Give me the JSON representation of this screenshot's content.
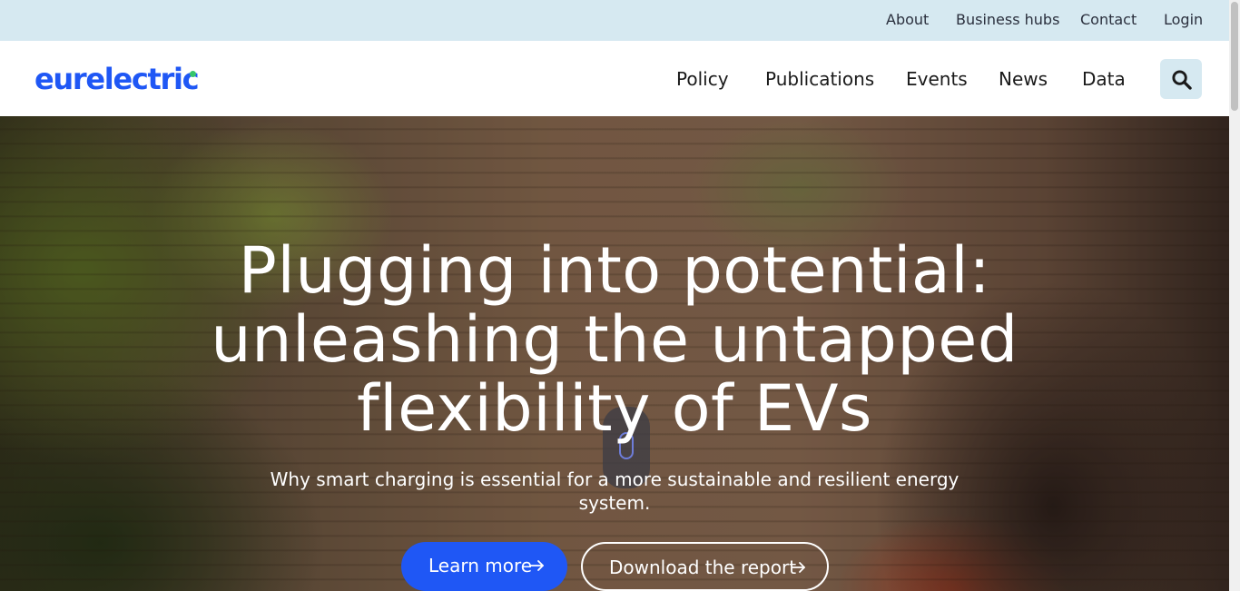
{
  "topbar": {
    "links": [
      "About",
      "Business hubs",
      "Contact",
      "Login"
    ]
  },
  "header": {
    "logo_text": "eurelectric",
    "nav": [
      "Policy",
      "Publications",
      "Events",
      "News",
      "Data"
    ],
    "search_icon": "search-icon"
  },
  "hero": {
    "title": "Plugging into potential: unleashing the untapped flexibility of EVs",
    "subtitle": "Why smart charging is essential for a more sustainable and resilient energy system.",
    "primary_button": "Learn more",
    "secondary_button": "Download the report",
    "arrow_icon": "arrow-right-icon"
  },
  "colors": {
    "brand_blue": "#1f57f5",
    "topbar_bg": "#d6e9f1",
    "logo_accent": "#36c56b"
  }
}
